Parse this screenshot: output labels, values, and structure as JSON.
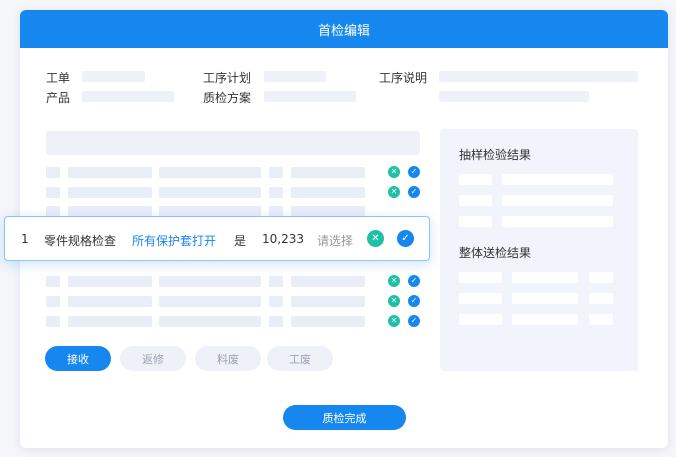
{
  "header": {
    "title": "首检编辑"
  },
  "form": {
    "work_order_label": "工单",
    "process_plan_label": "工序计划",
    "process_desc_label": "工序说明",
    "product_label": "产品",
    "qc_plan_label": "质检方案"
  },
  "table": {
    "highlighted_row": {
      "index": "1",
      "item": "零件规格检查",
      "standard": "所有保护套打开",
      "result": "是",
      "value": "10,233",
      "select_placeholder": "请选择"
    }
  },
  "panel": {
    "sample_title": "抽样检验结果",
    "overall_title": "整体送检结果"
  },
  "actions": {
    "accept": "接收",
    "rework": "返修",
    "scrap_material": "料废",
    "scrap_work": "工废",
    "complete": "质检完成"
  },
  "colors": {
    "primary": "#1787f0",
    "teal": "#1ec0a6"
  },
  "icons": {
    "reject": "close-circle-icon",
    "approve": "check-circle-icon"
  }
}
